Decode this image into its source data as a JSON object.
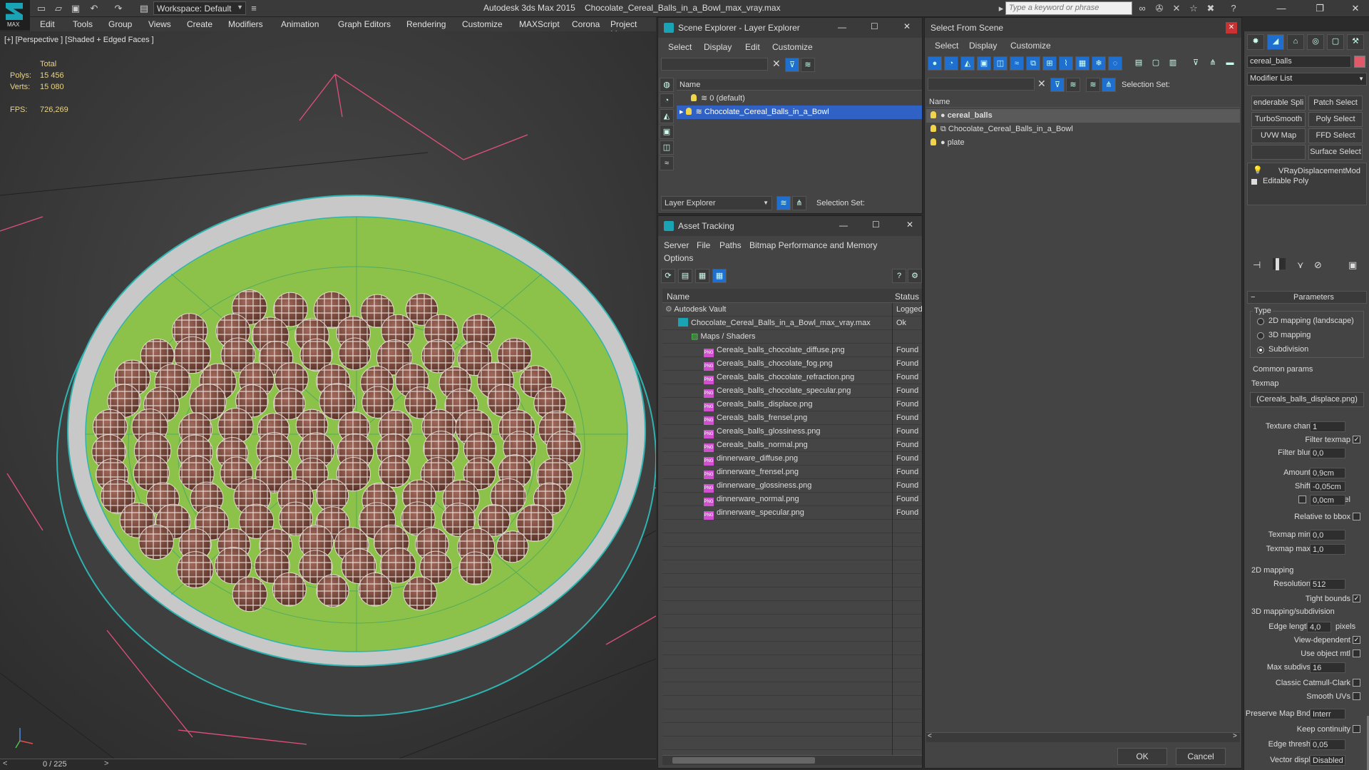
{
  "titlebar": {
    "app_logo_label": "MAX",
    "workspace": "Workspace: Default",
    "app_title": "Autodesk 3ds Max  2015",
    "file_title": "Chocolate_Cereal_Balls_in_a_Bowl_max_vray.max",
    "search_placeholder": "Type a keyword or phrase"
  },
  "menubar": [
    "Edit",
    "Tools",
    "Group",
    "Views",
    "Create",
    "Modifiers",
    "Animation",
    "Graph Editors",
    "Rendering",
    "Customize",
    "MAXScript",
    "Corona",
    "Project Man"
  ],
  "viewport": {
    "label": "[+] [Perspective ] [Shaded + Edged Faces ]",
    "stats": {
      "total_label": "Total",
      "polys_label": "Polys:",
      "polys_value": "15 456",
      "verts_label": "Verts:",
      "verts_value": "15 080",
      "fps_label": "FPS:",
      "fps_value": "726,269"
    },
    "timeline": "0 / 225"
  },
  "scene_explorer": {
    "title": "Scene Explorer - Layer Explorer",
    "menus": [
      "Select",
      "Display",
      "Edit",
      "Customize"
    ],
    "column_name": "Name",
    "rows": [
      "0 (default)",
      "Chocolate_Cereal_Balls_in_a_Bowl"
    ],
    "footer_dropdown": "Layer Explorer",
    "footer_selection_set": "Selection Set:"
  },
  "asset_tracking": {
    "title": "Asset Tracking",
    "menus": [
      "Server",
      "File",
      "Paths",
      "Bitmap Performance and Memory",
      "Options"
    ],
    "col_name": "Name",
    "col_status": "Status",
    "rows": [
      {
        "name": "Autodesk Vault",
        "status": "Logged",
        "indent": 0,
        "kind": "vault"
      },
      {
        "name": "Chocolate_Cereal_Balls_in_a_Bowl_max_vray.max",
        "status": "Ok",
        "indent": 1,
        "kind": "max"
      },
      {
        "name": "Maps / Shaders",
        "status": "",
        "indent": 2,
        "kind": "folder"
      },
      {
        "name": "Cereals_balls_chocolate_diffuse.png",
        "status": "Found",
        "indent": 3,
        "kind": "png"
      },
      {
        "name": "Cereals_balls_chocolate_fog.png",
        "status": "Found",
        "indent": 3,
        "kind": "png"
      },
      {
        "name": "Cereals_balls_chocolate_refraction.png",
        "status": "Found",
        "indent": 3,
        "kind": "png"
      },
      {
        "name": "Cereals_balls_chocolate_specular.png",
        "status": "Found",
        "indent": 3,
        "kind": "png"
      },
      {
        "name": "Cereals_balls_displace.png",
        "status": "Found",
        "indent": 3,
        "kind": "png"
      },
      {
        "name": "Cereals_balls_frensel.png",
        "status": "Found",
        "indent": 3,
        "kind": "png"
      },
      {
        "name": "Cereals_balls_glossiness.png",
        "status": "Found",
        "indent": 3,
        "kind": "png"
      },
      {
        "name": "Cereals_balls_normal.png",
        "status": "Found",
        "indent": 3,
        "kind": "png"
      },
      {
        "name": "dinnerware_diffuse.png",
        "status": "Found",
        "indent": 3,
        "kind": "png"
      },
      {
        "name": "dinnerware_frensel.png",
        "status": "Found",
        "indent": 3,
        "kind": "png"
      },
      {
        "name": "dinnerware_glossiness.png",
        "status": "Found",
        "indent": 3,
        "kind": "png"
      },
      {
        "name": "dinnerware_normal.png",
        "status": "Found",
        "indent": 3,
        "kind": "png"
      },
      {
        "name": "dinnerware_specular.png",
        "status": "Found",
        "indent": 3,
        "kind": "png"
      }
    ]
  },
  "select_from_scene": {
    "title": "Select From Scene",
    "menus": [
      "Select",
      "Display",
      "Customize"
    ],
    "selection_set": "Selection Set:",
    "column_name": "Name",
    "rows": [
      "cereal_balls",
      "Chocolate_Cereal_Balls_in_a_Bowl",
      "plate"
    ],
    "ok": "OK",
    "cancel": "Cancel"
  },
  "command_panel": {
    "object_name": "cereal_balls",
    "modifier_list": "Modifier List",
    "mod_buttons": [
      "enderable Spli",
      "Patch Select",
      "TurboSmooth",
      "Poly Select",
      "UVW Map",
      "FFD Select",
      "",
      "Surface Select"
    ],
    "stack": [
      "VRayDisplacementMod",
      "Editable Poly"
    ],
    "rollout": "Parameters",
    "type_label": "Type",
    "type_options": [
      "2D mapping (landscape)",
      "3D mapping",
      "Subdivision"
    ],
    "common_params": "Common params",
    "texmap_label": "Texmap",
    "texmap_value": "(Cereals_balls_displace.png)",
    "texture_chan_label": "Texture chan",
    "texture_chan_value": "1",
    "filter_texmap_label": "Filter texmap",
    "filter_blur_label": "Filter blur",
    "filter_blur_value": "0,0",
    "amount_label": "Amount",
    "amount_value": "0,9cm",
    "shift_label": "Shift",
    "shift_value": "-0,05cm",
    "water_level_label": "Water level",
    "water_level_value": "0,0cm",
    "relative_bbox_label": "Relative to bbox",
    "texmap_min_label": "Texmap min",
    "texmap_min_value": "0,0",
    "texmap_max_label": "Texmap max",
    "texmap_max_value": "1,0",
    "mapping_2d": "2D mapping",
    "resolution_label": "Resolution",
    "resolution_value": "512",
    "tight_bounds_label": "Tight bounds",
    "mapping_3d": "3D mapping/subdivision",
    "edge_length_label": "Edge length",
    "edge_length_value": "4,0",
    "pixels_label": "pixels",
    "view_dependent_label": "View-dependent",
    "use_object_mtl_label": "Use object mtl",
    "max_subdivs_label": "Max subdivs",
    "max_subdivs_value": "16",
    "classic_cc_label": "Classic Catmull-Clark",
    "smooth_uvs_label": "Smooth UVs",
    "preserve_map_label": "Preserve Map Bnd",
    "preserve_map_value": "Interr",
    "keep_continuity_label": "Keep continuity",
    "edge_thresh_label": "Edge thresh",
    "edge_thresh_value": "0,05",
    "vector_displ_label": "Vector displ",
    "vector_displ_value": "Disabled"
  },
  "colors": {
    "accent": "#1aa3b5",
    "selection": "#2f62c4",
    "bowl_green": "#8cc24a",
    "chocolate": "#7a4a3a"
  }
}
